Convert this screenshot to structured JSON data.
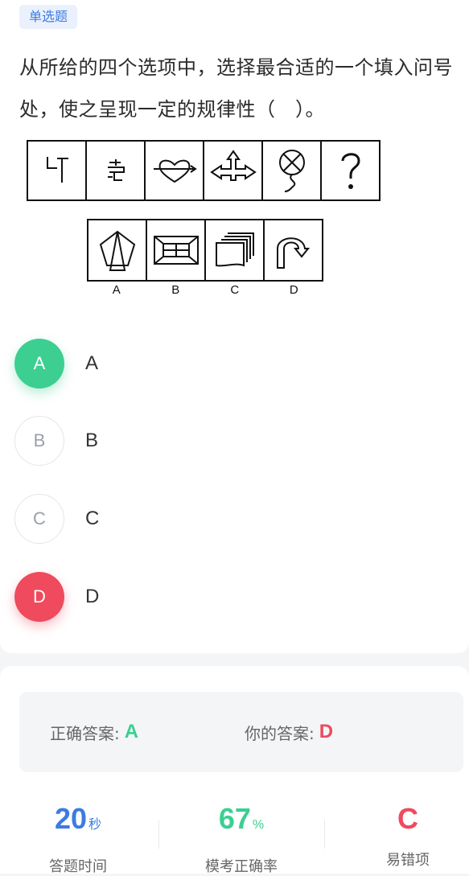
{
  "question": {
    "tag": "单选题",
    "text": "从所给的四个选项中，选择最合适的一个填入问号处，使之呈现一定的规律性（　）。",
    "figure_row1_icons": [
      "t-shape-icon",
      "maze-shape-icon",
      "heart-arrow-icon",
      "arrows-icon",
      "balloon-icon",
      "question-mark-icon"
    ],
    "figure_row2_icons": [
      "pentagon-triangle-icon",
      "frame-rect-icon",
      "stacked-cards-icon",
      "curved-arrow-icon"
    ],
    "figure_option_letters": [
      "A",
      "B",
      "C",
      "D"
    ]
  },
  "options": [
    {
      "letter": "A",
      "text": "A",
      "state": "correct"
    },
    {
      "letter": "B",
      "text": "B",
      "state": "plain"
    },
    {
      "letter": "C",
      "text": "C",
      "state": "plain"
    },
    {
      "letter": "D",
      "text": "D",
      "state": "wrong"
    }
  ],
  "answer": {
    "correct_label": "正确答案:",
    "correct_value": "A",
    "yours_label": "你的答案:",
    "yours_value": "D"
  },
  "stats": {
    "time_value": "20",
    "time_unit": "秒",
    "time_label": "答题时间",
    "rate_value": "67",
    "rate_unit": "%",
    "rate_label": "模考正确率",
    "mistake_value": "C",
    "mistake_label": "易错项"
  },
  "colors": {
    "accent_blue": "#3d7be0",
    "correct_green": "#3ccf91",
    "wrong_red": "#ef4a5d"
  }
}
